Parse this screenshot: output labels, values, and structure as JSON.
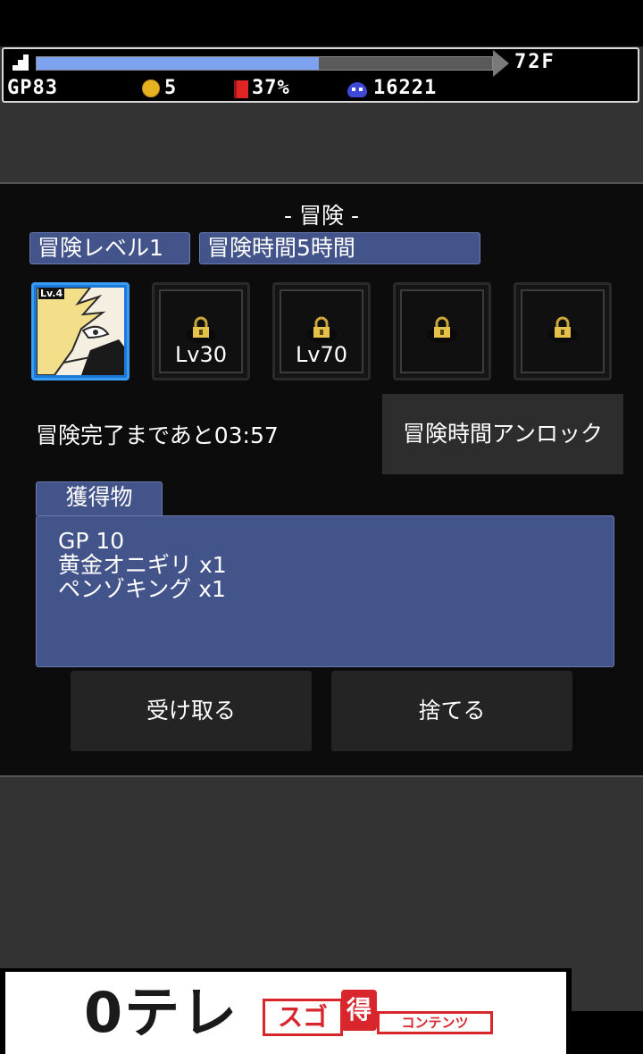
{
  "status": {
    "floor": "72F",
    "progress_fraction": 0.62,
    "gp": "GP83",
    "coins": "5",
    "book_percent": "37%",
    "souls": "16221"
  },
  "adventure": {
    "title": "- 冒険 -",
    "level_label": "冒険レベル1",
    "time_label": "冒険時間5時間",
    "slots": [
      {
        "state": "active",
        "badge": "Lv.4",
        "lock_icon": "",
        "level": ""
      },
      {
        "state": "locked",
        "level": "Lv30",
        "lock_icon": "lock-icon"
      },
      {
        "state": "locked",
        "level": "Lv70",
        "lock_icon": "lock-icon"
      },
      {
        "state": "locked",
        "level": "",
        "lock_icon": "lock-icon"
      },
      {
        "state": "locked",
        "level": "",
        "lock_icon": "lock-icon"
      }
    ],
    "remaining_text": "冒険完了まであと03:57",
    "unlock_button": "冒険時間アンロック",
    "loot_tab": "獲得物",
    "loot_items": [
      "GP 10",
      "黄金オニギリ x1",
      "ペンゾキング x1"
    ],
    "receive_button": "受け取る",
    "discard_button": "捨てる"
  },
  "ad": {
    "logo": "0テレ",
    "badge1": "スゴ",
    "badge2": "得",
    "badge3": "コンテンツ"
  },
  "colors": {
    "accent_blue": "#43548a",
    "progress": "#7da3f0",
    "active_slot": "#1d79d8",
    "ad_red": "#d9262c"
  }
}
